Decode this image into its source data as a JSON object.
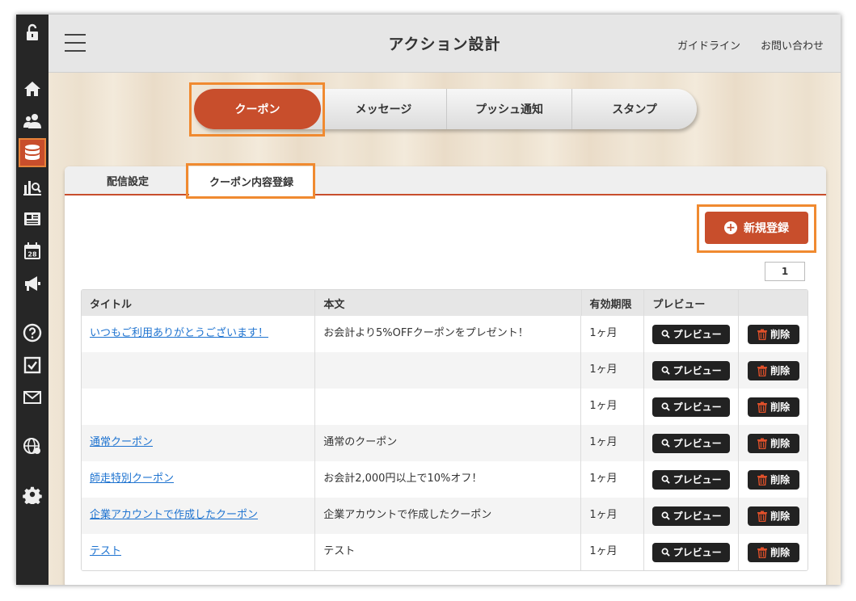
{
  "header": {
    "title": "アクション設計",
    "links": [
      "ガイドライン",
      "お問い合わせ"
    ]
  },
  "sidebar": {
    "icons": [
      "unlock-icon",
      "home-icon",
      "users-icon",
      "database-icon",
      "analytics-icon",
      "news-icon",
      "calendar-icon",
      "megaphone-icon",
      "help-icon",
      "checkbox-icon",
      "mail-icon",
      "globe-icon",
      "gear-icon"
    ],
    "calendar_day": "28",
    "active": "database-icon"
  },
  "main_tabs": [
    {
      "label": "クーポン",
      "active": true
    },
    {
      "label": "メッセージ",
      "active": false
    },
    {
      "label": "プッシュ通知",
      "active": false
    },
    {
      "label": "スタンプ",
      "active": false
    }
  ],
  "sub_tabs": [
    {
      "label": "配信設定",
      "active": false
    },
    {
      "label": "クーポン内容登録",
      "active": true
    }
  ],
  "new_button": {
    "label": "新規登録"
  },
  "pager": {
    "current": "1"
  },
  "table": {
    "headers": [
      "タイトル",
      "本文",
      "有効期限",
      "プレビュー",
      ""
    ],
    "preview_label": "プレビュー",
    "delete_label": "削除",
    "rows": [
      {
        "title": "いつもご利用ありがとうございます！",
        "body": "お会計より5%OFFクーポンをプレゼント！",
        "expiry": "1ヶ月"
      },
      {
        "title": "",
        "body": "",
        "expiry": "1ヶ月"
      },
      {
        "title": "",
        "body": "",
        "expiry": "1ヶ月"
      },
      {
        "title": "通常クーポン",
        "body": "通常のクーポン",
        "expiry": "1ヶ月"
      },
      {
        "title": "師走特別クーポン",
        "body": "お会計2,000円以上で10%オフ！",
        "expiry": "1ヶ月"
      },
      {
        "title": "企業アカウントで作成したクーポン",
        "body": "企業アカウントで作成したクーポン",
        "expiry": "1ヶ月"
      },
      {
        "title": "テスト",
        "body": "テスト",
        "expiry": "1ヶ月"
      }
    ]
  },
  "colors": {
    "accent": "#c84e2c",
    "highlight": "#f08a30",
    "sidebar": "#262626",
    "link": "#1e73d0"
  }
}
